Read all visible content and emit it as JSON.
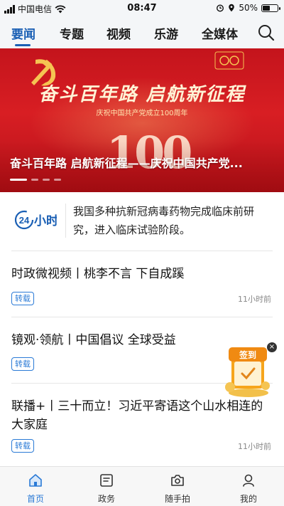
{
  "status_bar": {
    "carrier": "中国电信",
    "time": "08:47",
    "battery": "50%",
    "battery_level": 0.5
  },
  "nav": {
    "tabs": [
      {
        "label": "要闻",
        "active": true
      },
      {
        "label": "专题"
      },
      {
        "label": "视频"
      },
      {
        "label": "乐游"
      },
      {
        "label": "全媒体"
      }
    ],
    "search_icon": "search-icon"
  },
  "banner": {
    "headline": "奋斗百年路 启航新征程",
    "subheadline": "庆祝中国共产党成立100周年",
    "big_number": "100",
    "caption": "奋斗百年路 启航新征程——庆祝中国共产党...",
    "dots": 4,
    "active_dot": 0
  },
  "news24": {
    "logo_number": "24",
    "logo_label": "小时",
    "text": "我国多种抗新冠病毒药物完成临床前研究，进入临床试验阶段。"
  },
  "articles": [
    {
      "title": "时政微视频丨桃李不言 下自成蹊",
      "tag": "转载",
      "time": "11小时前"
    },
    {
      "title": "镜观·领航丨中国倡议 全球受益",
      "tag": "转载",
      "time": ""
    },
    {
      "title": "联播+丨三十而立！习近平寄语这个山水相连的大家庭",
      "tag": "转载",
      "time": "11小时前"
    }
  ],
  "floating": {
    "label": "签到",
    "close": "×"
  },
  "tabbar": [
    {
      "label": "首页",
      "icon": "home-icon",
      "active": true
    },
    {
      "label": "政务",
      "icon": "document-icon"
    },
    {
      "label": "随手拍",
      "icon": "camera-icon"
    },
    {
      "label": "我的",
      "icon": "user-icon"
    }
  ],
  "colors": {
    "accent": "#1a5fb4",
    "tag": "#2a7ad6",
    "banner_red": "#d81e23"
  }
}
